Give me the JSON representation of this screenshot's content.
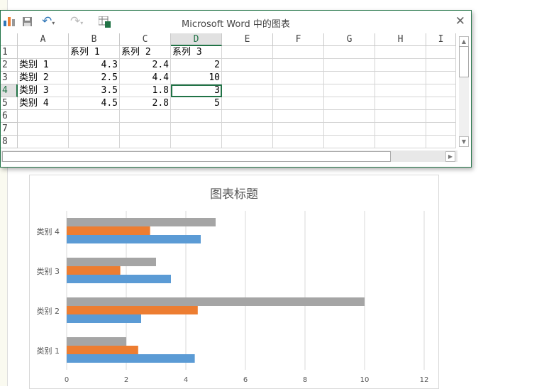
{
  "window": {
    "title": "Microsoft Word 中的图表",
    "close": "✕"
  },
  "toolbar": {
    "chart_icon": "chart-icon",
    "save_icon": "save-icon",
    "undo_icon": "undo-icon",
    "redo_icon": "redo-icon",
    "excel_icon": "edit-in-excel-icon"
  },
  "columns": [
    "A",
    "B",
    "C",
    "D",
    "E",
    "F",
    "G",
    "H",
    "I"
  ],
  "rows": [
    "1",
    "2",
    "3",
    "4",
    "5",
    "6",
    "7",
    "8"
  ],
  "cells": [
    [
      "",
      "系列 1",
      "系列 2",
      "系列 3"
    ],
    [
      "类别 1",
      "4.3",
      "2.4",
      "2"
    ],
    [
      "类别 2",
      "2.5",
      "4.4",
      "10"
    ],
    [
      "类别 3",
      "3.5",
      "1.8",
      "3"
    ],
    [
      "类别 4",
      "4.5",
      "2.8",
      "5"
    ]
  ],
  "chart_data": {
    "type": "bar",
    "orientation": "horizontal",
    "title": "图表标题",
    "categories": [
      "类别 1",
      "类别 2",
      "类别 3",
      "类别 4"
    ],
    "series": [
      {
        "name": "系列 1",
        "values": [
          4.3,
          2.5,
          3.5,
          4.5
        ],
        "color": "#5b9bd5"
      },
      {
        "name": "系列 2",
        "values": [
          2.4,
          4.4,
          1.8,
          2.8
        ],
        "color": "#ed7d31"
      },
      {
        "name": "系列 3",
        "values": [
          2,
          10,
          3,
          5
        ],
        "color": "#a5a5a5"
      }
    ],
    "xlim": [
      0,
      12
    ],
    "xticks": [
      "0",
      "2",
      "4",
      "6",
      "8",
      "10",
      "12"
    ],
    "grid": true
  }
}
